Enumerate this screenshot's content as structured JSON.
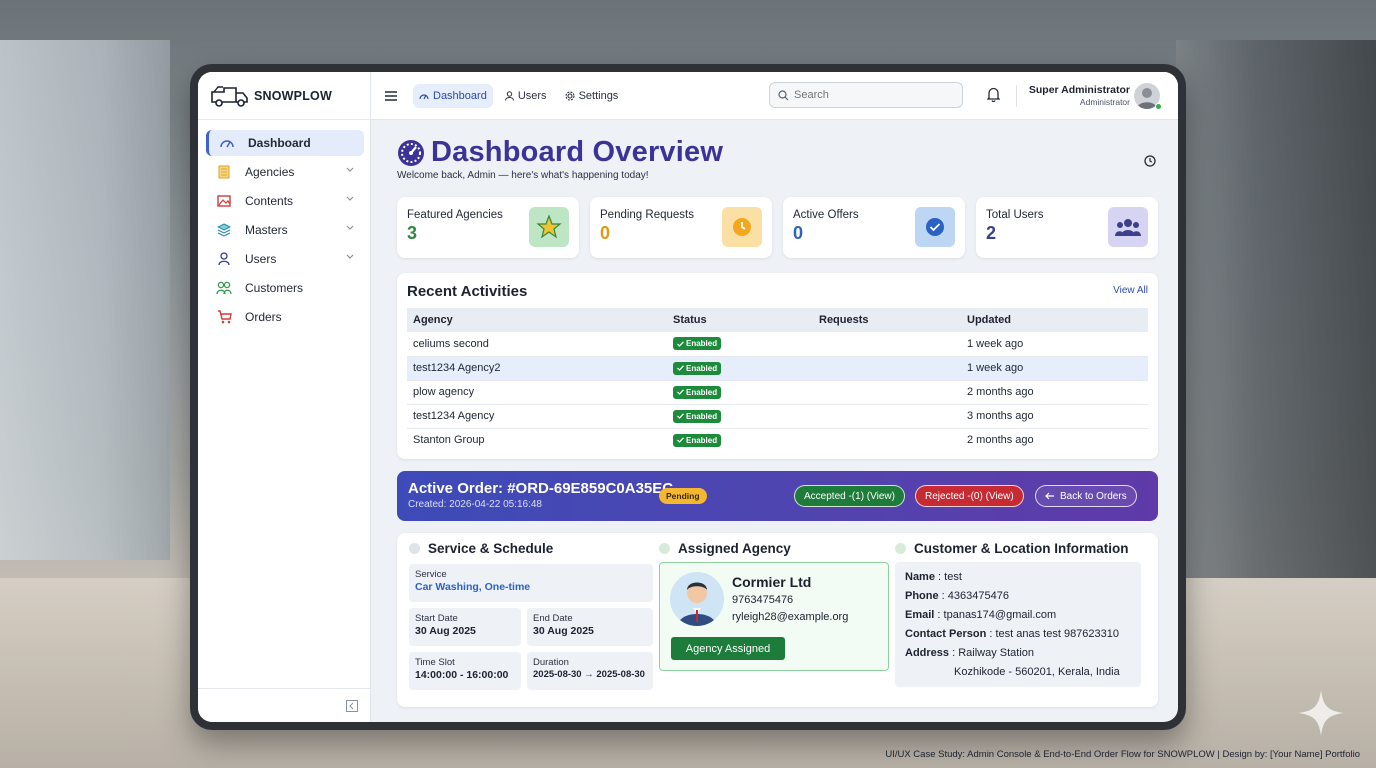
{
  "brand": {
    "name": "SNOWPLOW"
  },
  "sidebar": {
    "items": [
      {
        "label": "Dashboard"
      },
      {
        "label": "Agencies"
      },
      {
        "label": "Contents"
      },
      {
        "label": "Masters"
      },
      {
        "label": "Users"
      },
      {
        "label": "Customers"
      },
      {
        "label": "Orders"
      }
    ]
  },
  "topbar": {
    "tabs": [
      {
        "label": "Dashboard"
      },
      {
        "label": "Users"
      },
      {
        "label": "Settings"
      }
    ],
    "search_placeholder": "Search",
    "user_name": "Super Administrator",
    "user_role": "Administrator"
  },
  "page": {
    "title": "Dashboard Overview",
    "subtitle": "Welcome back, Admin — here's what's happening today!"
  },
  "stats": [
    {
      "label": "Featured Agencies",
      "value": "3",
      "color": "#2e8a3c"
    },
    {
      "label": "Pending Requests",
      "value": "0",
      "color": "#e09a12"
    },
    {
      "label": "Active Offers",
      "value": "0",
      "color": "#2b63c4"
    },
    {
      "label": "Total Users",
      "value": "2",
      "color": "#3c3f8c"
    }
  ],
  "recent": {
    "title": "Recent Activities",
    "view_all": "View All",
    "columns": [
      "Agency",
      "Status",
      "Requests",
      "Updated"
    ],
    "rows": [
      {
        "agency": "celiums second",
        "status": "Enabled",
        "requests": "",
        "updated": "1 week ago"
      },
      {
        "agency": "test1234 Agency2",
        "status": "Enabled",
        "requests": "",
        "updated": "1 week ago"
      },
      {
        "agency": "plow agency",
        "status": "Enabled",
        "requests": "",
        "updated": "2 months ago"
      },
      {
        "agency": "test1234 Agency",
        "status": "Enabled",
        "requests": "",
        "updated": "3 months ago"
      },
      {
        "agency": "Stanton Group",
        "status": "Enabled",
        "requests": "",
        "updated": "2 months ago"
      }
    ]
  },
  "order": {
    "title": "Active Order: #ORD-69E859C0A35EC",
    "created": "Created: 2026-04-22 05:16:48",
    "status": "Pending",
    "accepted": "Accepted -(1) (View)",
    "rejected": "Rejected -(0) (View)",
    "back": "Back to Orders"
  },
  "service": {
    "title": "Service & Schedule",
    "service_label": "Service",
    "service_value": "Car Washing, One-time",
    "start_label": "Start Date",
    "start_value": "30 Aug 2025",
    "end_label": "End Date",
    "end_value": "30 Aug 2025",
    "slot_label": "Time Slot",
    "slot_value": "14:00:00 - 16:00:00",
    "duration_label": "Duration",
    "duration_value": "2025-08-30 → 2025-08-30"
  },
  "agency": {
    "title": "Assigned Agency",
    "name": "Cormier Ltd",
    "phone": "9763475476",
    "email": "ryleigh28@example.org",
    "button": "Agency Assigned"
  },
  "customer": {
    "title": "Customer & Location Information",
    "name_label": "Name",
    "name": "test",
    "phone_label": "Phone",
    "phone": "4363475476",
    "email_label": "Email",
    "email": "tpanas174@gmail.com",
    "contact_label": "Contact Person",
    "contact": "test anas test 987623310",
    "address_label": "Address",
    "address_line1": "Railway Station",
    "address_line2": "Kozhikode - 560201, Kerala, India"
  },
  "caption": "UI/UX Case Study: Admin Console & End-to-End Order Flow for SNOWPLOW | Design by: [Your Name] Portfolio"
}
